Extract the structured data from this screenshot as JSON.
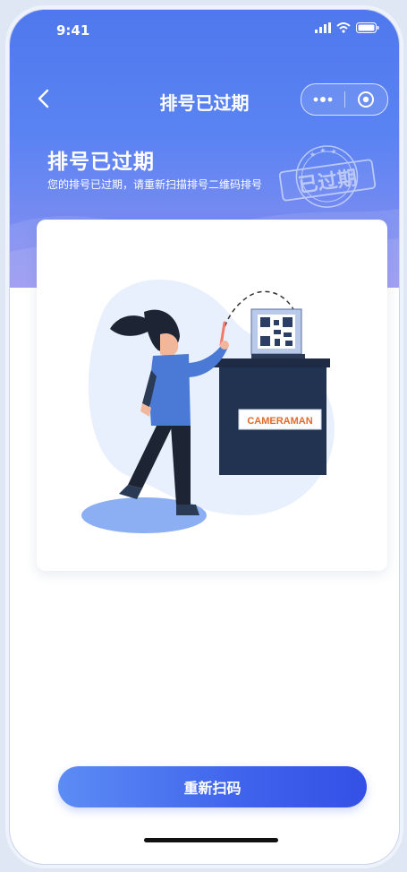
{
  "status": {
    "time": "9:41"
  },
  "nav": {
    "title": "排号已过期"
  },
  "header": {
    "title": "排号已过期",
    "description": "您的排号已过期，请重新扫描排号二维码排号"
  },
  "stamp": {
    "text": "已过期"
  },
  "illustration": {
    "counter_label": "CAMERAMAN"
  },
  "action": {
    "rescan_label": "重新扫码"
  },
  "colors": {
    "primary": "#4f78ee",
    "button": "#3f63ec"
  }
}
